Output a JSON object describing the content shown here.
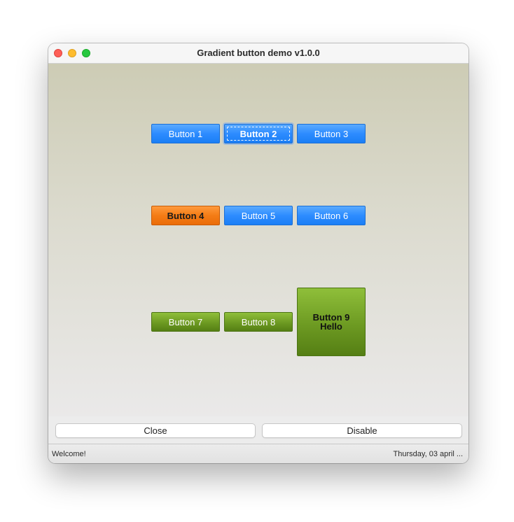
{
  "window": {
    "title": "Gradient button demo v1.0.0"
  },
  "gradient_buttons": [
    {
      "label": "Button 1",
      "color": "blue"
    },
    {
      "label": "Button 2",
      "color": "blue",
      "focused": true
    },
    {
      "label": "Button 3",
      "color": "blue"
    },
    {
      "label": "Button 4",
      "color": "orange"
    },
    {
      "label": "Button 5",
      "color": "blue"
    },
    {
      "label": "Button 6",
      "color": "blue"
    },
    {
      "label": "Button 7",
      "color": "green"
    },
    {
      "label": "Button 8",
      "color": "green"
    },
    {
      "label": "Button 9\nHello",
      "color": "green"
    }
  ],
  "colors": {
    "blue": "#2d8cff",
    "orange": "#f47c16",
    "green": "#6d9a22"
  },
  "actions": {
    "close_label": "Close",
    "disable_label": "Disable"
  },
  "status": {
    "left": "Welcome!",
    "right": "Thursday, 03 april ..."
  }
}
